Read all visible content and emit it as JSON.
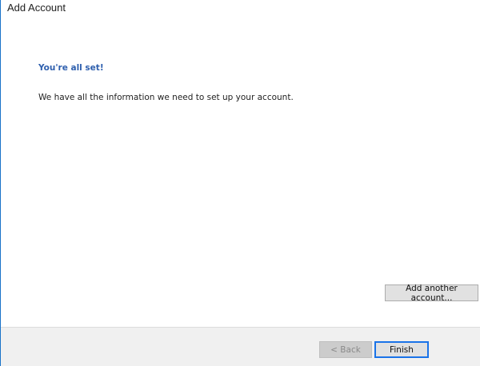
{
  "window": {
    "title": "Add Account"
  },
  "main": {
    "heading": "You're all set!",
    "message": "We have all the information we need to set up your account.",
    "add_another_label": "Add another account..."
  },
  "footer": {
    "back_label": "< Back",
    "finish_label": "Finish"
  },
  "colors": {
    "heading": "#2e5fae",
    "accent": "#1a73e8",
    "footer_bg": "#f0f0f0"
  }
}
